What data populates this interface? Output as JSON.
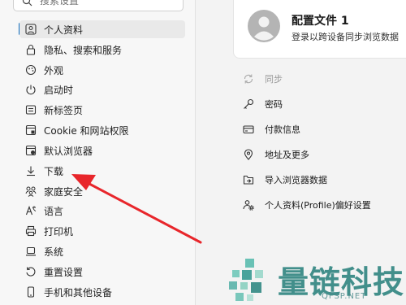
{
  "search": {
    "placeholder": "搜索设置"
  },
  "sidebar": {
    "items": [
      {
        "label": "个人资料",
        "icon": "profile-icon"
      },
      {
        "label": "隐私、搜索和服务",
        "icon": "lock-icon"
      },
      {
        "label": "外观",
        "icon": "appearance-icon"
      },
      {
        "label": "启动时",
        "icon": "power-icon"
      },
      {
        "label": "新标签页",
        "icon": "new-tab-icon"
      },
      {
        "label": "Cookie 和网站权限",
        "icon": "site-permissions-icon"
      },
      {
        "label": "默认浏览器",
        "icon": "default-browser-icon"
      },
      {
        "label": "下载",
        "icon": "download-icon"
      },
      {
        "label": "家庭安全",
        "icon": "family-icon"
      },
      {
        "label": "语言",
        "icon": "language-icon"
      },
      {
        "label": "打印机",
        "icon": "printer-icon"
      },
      {
        "label": "系统",
        "icon": "system-icon"
      },
      {
        "label": "重置设置",
        "icon": "reset-icon"
      },
      {
        "label": "手机和其他设备",
        "icon": "phone-icon"
      }
    ],
    "active_index": 0
  },
  "profile": {
    "name": "配置文件 1",
    "subtitle": "登录以跨设备同步浏览数据"
  },
  "menu": {
    "items": [
      {
        "label": "同步",
        "icon": "sync-icon",
        "disabled": true
      },
      {
        "label": "密码",
        "icon": "key-icon"
      },
      {
        "label": "付款信息",
        "icon": "card-icon"
      },
      {
        "label": "地址及更多",
        "icon": "location-icon"
      },
      {
        "label": "导入浏览器数据",
        "icon": "import-icon"
      },
      {
        "label": "个人资料(Profile)偏好设置",
        "icon": "profile-settings-icon"
      }
    ]
  },
  "watermark": {
    "text": "量链科技",
    "url": "QFSP.NET"
  },
  "colors": {
    "accent": "#0f6cbd",
    "annotation": "#e8262b",
    "watermark": "#1c7a75"
  }
}
